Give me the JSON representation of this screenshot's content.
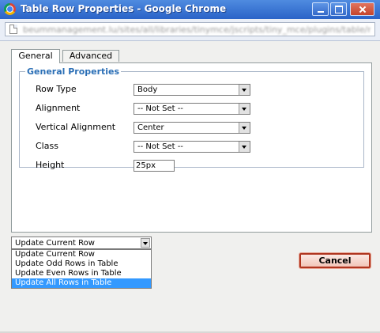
{
  "window": {
    "title": "Table Row Properties - Google Chrome",
    "url": "beummanagement.lu/sites/all/libraries/tinymce/jscripts/tiny_mce/plugins/table/ro"
  },
  "tabs": [
    {
      "label": "General",
      "active": true
    },
    {
      "label": "Advanced",
      "active": false
    }
  ],
  "general_properties": {
    "legend": "General Properties",
    "row_type": {
      "label": "Row Type",
      "value": "Body"
    },
    "alignment": {
      "label": "Alignment",
      "value": "-- Not Set --"
    },
    "vertical_alignment": {
      "label": "Vertical Alignment",
      "value": "Center"
    },
    "class": {
      "label": "Class",
      "value": "-- Not Set --"
    },
    "height": {
      "label": "Height",
      "value": "25px"
    }
  },
  "update_action": {
    "selected": "Update Current Row",
    "options": [
      {
        "label": "Update Current Row"
      },
      {
        "label": "Update Odd Rows in Table"
      },
      {
        "label": "Update Even Rows in Table"
      },
      {
        "label": "Update All Rows in Table",
        "highlighted": true
      }
    ]
  },
  "buttons": {
    "cancel": "Cancel"
  },
  "colors": {
    "titlebar": "#2a63c8",
    "legend_text": "#2b6fb6",
    "highlight": "#3399ff",
    "cancel_border": "#b0351f"
  }
}
